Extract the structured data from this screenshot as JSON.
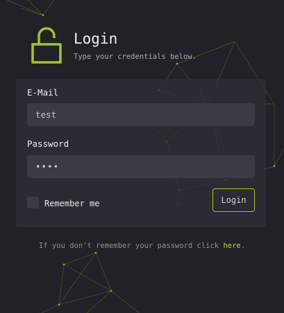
{
  "header": {
    "title": "Login",
    "subtitle": "Type your credentials below.",
    "icon": "unlocked-padlock-icon",
    "accent_color": "#a7c520"
  },
  "form": {
    "email_label": "E-Mail",
    "email_value": "test",
    "password_label": "Password",
    "password_value": "test",
    "remember_label": "Remember me",
    "remember_checked": false,
    "login_button": "Login"
  },
  "footer": {
    "text": "If you don't remember your password click ",
    "link_text": "here",
    "trailing": "."
  }
}
